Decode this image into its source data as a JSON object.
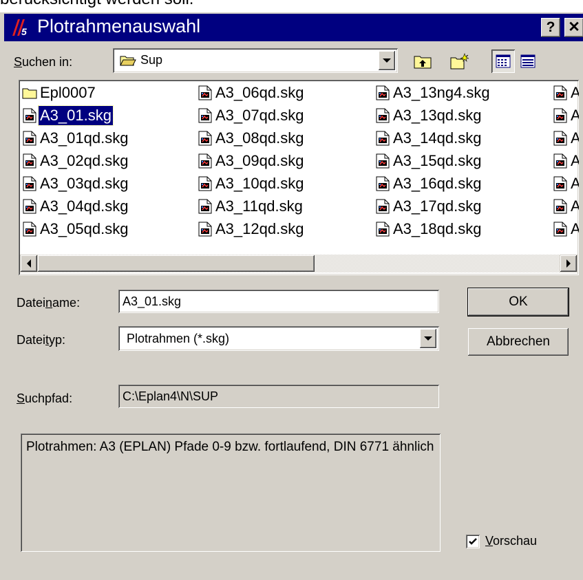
{
  "top_clipped_text": "berücksichtigt werden soll.",
  "window": {
    "title": "Plotrahmenauswahl",
    "help_label": "?",
    "close_label": "✕",
    "app_icon": "eplan-logo"
  },
  "lookin": {
    "label_hot": "S",
    "label_rest": "uchen in:",
    "value": "Sup",
    "folder_icon": "open-folder-icon"
  },
  "toolbar": {
    "up_icon": "up-one-level-icon",
    "new_folder_icon": "new-folder-icon",
    "list_icon": "list-view-icon",
    "details_icon": "details-view-icon",
    "active_view": "list"
  },
  "files": {
    "columns": [
      [
        {
          "name": "Epl0007",
          "type": "folder"
        },
        {
          "name": "A3_01.skg",
          "type": "file",
          "selected": true
        },
        {
          "name": "A3_01qd.skg",
          "type": "file"
        },
        {
          "name": "A3_02qd.skg",
          "type": "file"
        },
        {
          "name": "A3_03qd.skg",
          "type": "file"
        },
        {
          "name": "A3_04qd.skg",
          "type": "file"
        },
        {
          "name": "A3_05qd.skg",
          "type": "file"
        }
      ],
      [
        {
          "name": "A3_06qd.skg",
          "type": "file"
        },
        {
          "name": "A3_07qd.skg",
          "type": "file"
        },
        {
          "name": "A3_08qd.skg",
          "type": "file"
        },
        {
          "name": "A3_09qd.skg",
          "type": "file"
        },
        {
          "name": "A3_10qd.skg",
          "type": "file"
        },
        {
          "name": "A3_11qd.skg",
          "type": "file"
        },
        {
          "name": "A3_12qd.skg",
          "type": "file"
        }
      ],
      [
        {
          "name": "A3_13ng4.skg",
          "type": "file"
        },
        {
          "name": "A3_13qd.skg",
          "type": "file"
        },
        {
          "name": "A3_14qd.skg",
          "type": "file"
        },
        {
          "name": "A3_15qd.skg",
          "type": "file"
        },
        {
          "name": "A3_16qd.skg",
          "type": "file"
        },
        {
          "name": "A3_17qd.skg",
          "type": "file"
        },
        {
          "name": "A3_18qd.skg",
          "type": "file"
        }
      ],
      [
        {
          "name": "A",
          "type": "file"
        },
        {
          "name": "A",
          "type": "file"
        },
        {
          "name": "A",
          "type": "file"
        },
        {
          "name": "A",
          "type": "file"
        },
        {
          "name": "A",
          "type": "file"
        },
        {
          "name": "A",
          "type": "file"
        },
        {
          "name": "A",
          "type": "file"
        }
      ]
    ]
  },
  "scrollbar": {
    "position_fraction": 0.0,
    "visible_fraction": 0.53
  },
  "filename": {
    "label_pre": "Datei",
    "label_hot": "n",
    "label_post": "ame:",
    "value": "A3_01.skg"
  },
  "filetype": {
    "label_pre": "Datei",
    "label_hot": "t",
    "label_post": "yp:",
    "value": "Plotrahmen (*.skg)"
  },
  "searchpath": {
    "label_hot": "S",
    "label_rest": "uchpfad:",
    "value": "C:\\Eplan4\\N\\SUP"
  },
  "description": "Plotrahmen: A3 (EPLAN)  Pfade 0-9 bzw. fortlaufend, DIN 6771 ähnlich",
  "buttons": {
    "ok": "OK",
    "cancel": "Abbrechen"
  },
  "preview": {
    "label_hot": "V",
    "label_rest": "orschau",
    "checked": true
  }
}
